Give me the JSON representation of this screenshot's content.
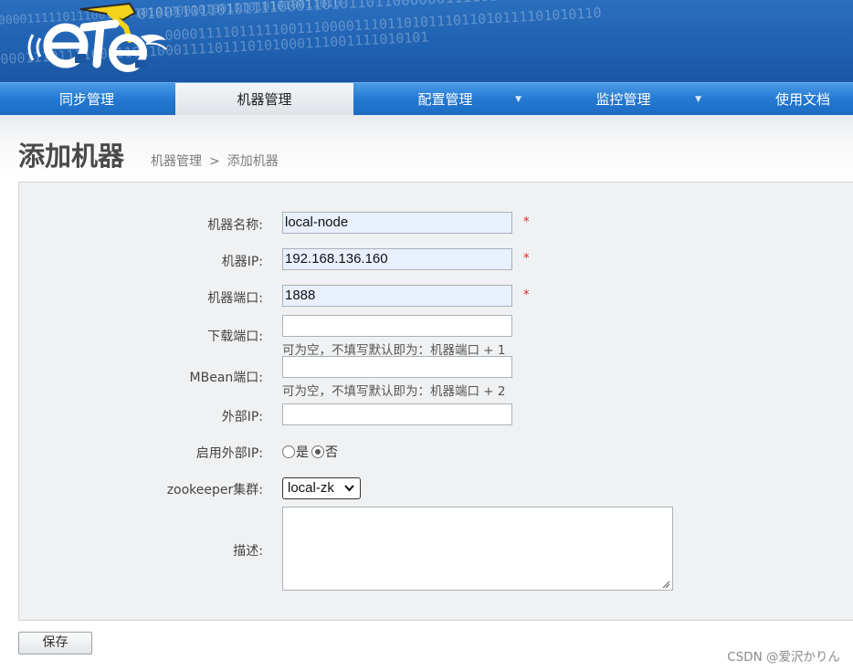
{
  "header": {
    "binary_lines": [
      "0100110110101111000110101101100000011110111010100110",
      "00001111011111001110000111011010111011010111101010110",
      "0001110111100111011000111101110101000111001111010101",
      "0000011111011100111010101000101001110101010011010"
    ],
    "logo_text": "eTe"
  },
  "nav": {
    "items": [
      {
        "label": "同步管理"
      },
      {
        "label": "机器管理"
      },
      {
        "label": "配置管理"
      },
      {
        "label": "监控管理"
      },
      {
        "label": "使用文档"
      }
    ],
    "active_index": 1,
    "caret": "▼"
  },
  "page": {
    "title": "添加机器",
    "breadcrumb": [
      "机器管理",
      ">",
      "添加机器"
    ]
  },
  "form": {
    "name_label": "机器名称:",
    "name_value": "local-node",
    "ip_label": "机器IP:",
    "ip_value": "192.168.136.160",
    "port_label": "机器端口:",
    "port_value": "1888",
    "download_port_label": "下载端口:",
    "download_port_value": "",
    "download_port_hint": "可为空，不填写默认即为：机器端口 + 1",
    "mbean_port_label": "MBean端口:",
    "mbean_port_value": "",
    "mbean_port_hint": "可为空，不填写默认即为：机器端口 + 2",
    "external_ip_label": "外部IP:",
    "external_ip_value": "",
    "enable_external_label": "启用外部IP:",
    "radio_yes": "是",
    "radio_no": "否",
    "radio_selected": "否",
    "zookeeper_label": "zookeeper集群:",
    "zookeeper_value": "local-zk",
    "desc_label": "描述:",
    "desc_value": "",
    "required_mark": "*"
  },
  "actions": {
    "save_label": "保存"
  },
  "watermark": "CSDN @爱沢かりん",
  "colors": {
    "banner": "#2062b2",
    "nav": "#2479d2",
    "active_tab": "#dde2e7",
    "panel": "#f0f1f2",
    "autofill": "#e8f0fe",
    "required": "#e02020"
  }
}
